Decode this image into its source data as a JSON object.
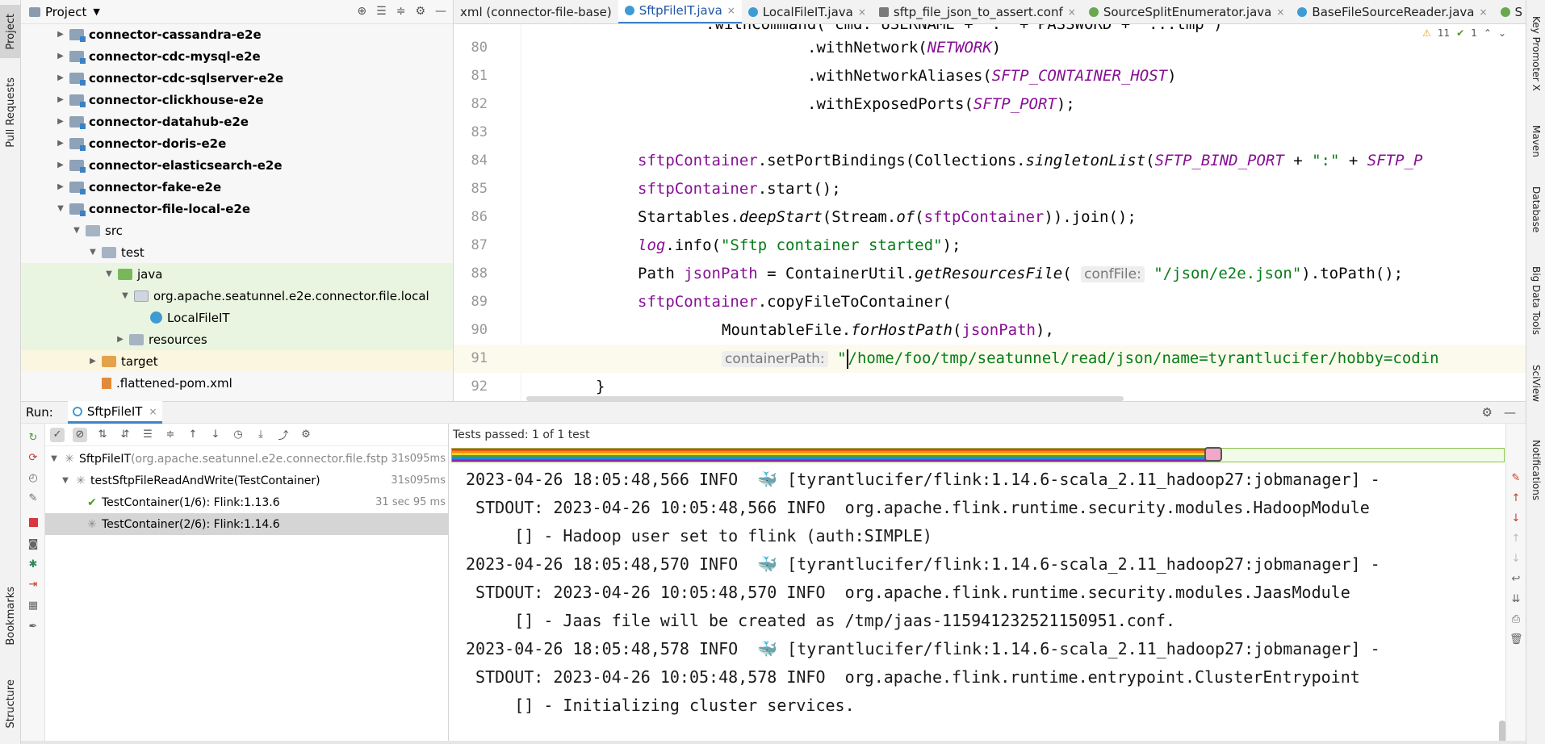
{
  "left_stripe": {
    "project": "Project",
    "pull_requests": "Pull Requests",
    "bookmarks": "Bookmarks",
    "structure": "Structure"
  },
  "right_stripe": {
    "key_promoter": "Key Promoter X",
    "maven": "Maven",
    "database": "Database",
    "big_data": "Big Data Tools",
    "sciview": "SciView",
    "notifications": "Notifications"
  },
  "project": {
    "title": "Project",
    "tree": [
      {
        "label": "connector-cassandra-e2e"
      },
      {
        "label": "connector-cdc-mysql-e2e"
      },
      {
        "label": "connector-cdc-sqlserver-e2e"
      },
      {
        "label": "connector-clickhouse-e2e"
      },
      {
        "label": "connector-datahub-e2e"
      },
      {
        "label": "connector-doris-e2e"
      },
      {
        "label": "connector-elasticsearch-e2e"
      },
      {
        "label": "connector-fake-e2e"
      },
      {
        "label": "connector-file-local-e2e"
      },
      {
        "label": "src"
      },
      {
        "label": "test"
      },
      {
        "label": "java"
      },
      {
        "label": "org.apache.seatunnel.e2e.connector.file.local"
      },
      {
        "label": "LocalFileIT"
      },
      {
        "label": "resources"
      },
      {
        "label": "target"
      },
      {
        "label": ".flattened-pom.xml"
      }
    ]
  },
  "tabs": [
    {
      "label": "xml (connector-file-base)"
    },
    {
      "label": "SftpFileIT.java"
    },
    {
      "label": "LocalFileIT.java"
    },
    {
      "label": "sftp_file_json_to_assert.conf"
    },
    {
      "label": "SourceSplitEnumerator.java"
    },
    {
      "label": "BaseFileSourceReader.java"
    },
    {
      "label": "S"
    }
  ],
  "editor": {
    "warnings": "11",
    "oks": "1",
    "line_numbers": [
      "80",
      "81",
      "82",
      "83",
      "84",
      "85",
      "86",
      "87",
      "88",
      "89",
      "90",
      "91",
      "92"
    ],
    "top_partial": ".withCommand( cmd: USERNAME + \":\" + PASSWORD + \":::tmp\")",
    "l80_a": ".withNetwork(",
    "l80_b": "NETWORK",
    "l80_c": ")",
    "l81_a": ".withNetworkAliases(",
    "l81_b": "SFTP_CONTAINER_HOST",
    "l81_c": ")",
    "l82_a": ".withExposedPorts(",
    "l82_b": "SFTP_PORT",
    "l82_c": ");",
    "l84_a": "sftpContainer",
    "l84_b": ".setPortBindings(Collections.",
    "l84_c": "singletonList",
    "l84_d": "(",
    "l84_e": "SFTP_BIND_PORT",
    "l84_f": " + ",
    "l84_g": "\":\"",
    "l84_h": " + ",
    "l84_i": "SFTP_P",
    "l85_a": "sftpContainer",
    "l85_b": ".start();",
    "l86_a": "Startables.",
    "l86_b": "deepStart",
    "l86_c": "(Stream.",
    "l86_d": "of",
    "l86_e": "(",
    "l86_f": "sftpContainer",
    "l86_g": ")).join();",
    "l87_a": "log",
    "l87_b": ".info(",
    "l87_c": "\"Sftp container started\"",
    "l87_d": ");",
    "l88_a": "Path ",
    "l88_b": "jsonPath",
    "l88_c": " = ContainerUtil.",
    "l88_d": "getResourcesFile",
    "l88_e": "( ",
    "l88_hint": "confFile:",
    "l88_f": " ",
    "l88_g": "\"/json/e2e.json\"",
    "l88_h": ").toPath();",
    "l89_a": "sftpContainer",
    "l89_b": ".copyFileToContainer(",
    "l90_a": "MountableFile.",
    "l90_b": "forHostPath",
    "l90_c": "(",
    "l90_d": "jsonPath",
    "l90_e": "),",
    "l91_hint": "containerPath:",
    "l91_a": " \"",
    "l91_b": "/home/foo/tmp/seatunnel/read/json/name=tyrantlucifer/hobby=codin",
    "l92": "}"
  },
  "run": {
    "label": "Run:",
    "config": "SftpFileIT",
    "summary": "Tests passed: 1 of 1 test",
    "progress_fraction": 0.72,
    "tests": [
      {
        "name": "SftpFileIT",
        "pkg": " (org.apache.seatunnel.e2e.connector.file.fstp",
        "time": "31s095ms",
        "status": "running"
      },
      {
        "name": "testSftpFileReadAndWrite(TestContainer)",
        "pkg": "",
        "time": "31s095ms",
        "status": "running"
      },
      {
        "name": "TestContainer(1/6): Flink:1.13.6",
        "pkg": "",
        "time": "31 sec 95 ms",
        "status": "passed"
      },
      {
        "name": "TestContainer(2/6): Flink:1.14.6",
        "pkg": "",
        "time": "",
        "status": "running"
      }
    ],
    "console": [
      "2023-04-26 18:05:48,566 INFO  🐳 [tyrantlucifer/flink:1.14.6-scala_2.11_hadoop27:jobmanager] -",
      " STDOUT: 2023-04-26 10:05:48,566 INFO  org.apache.flink.runtime.security.modules.HadoopModule",
      "     [] - Hadoop user set to flink (auth:SIMPLE)",
      "2023-04-26 18:05:48,570 INFO  🐳 [tyrantlucifer/flink:1.14.6-scala_2.11_hadoop27:jobmanager] -",
      " STDOUT: 2023-04-26 10:05:48,570 INFO  org.apache.flink.runtime.security.modules.JaasModule",
      "     [] - Jaas file will be created as /tmp/jaas-115941232521150951.conf.",
      "2023-04-26 18:05:48,578 INFO  🐳 [tyrantlucifer/flink:1.14.6-scala_2.11_hadoop27:jobmanager] -",
      " STDOUT: 2023-04-26 10:05:48,578 INFO  org.apache.flink.runtime.entrypoint.ClusterEntrypoint",
      "     [] - Initializing cluster services."
    ]
  }
}
